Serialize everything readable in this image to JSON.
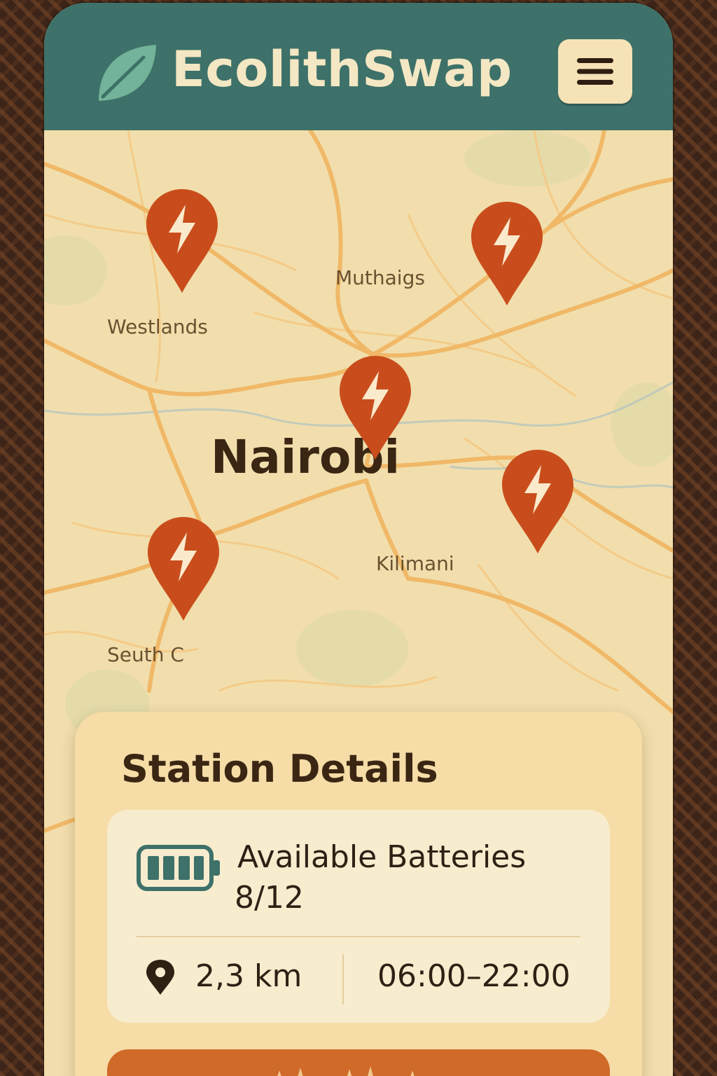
{
  "header": {
    "title": "EcolithSwap",
    "logo_icon": "leaf-icon",
    "menu_icon": "hamburger-menu-icon"
  },
  "map": {
    "city": "Nairobi",
    "places": [
      "Westlands",
      "Muthaigs",
      "Kilimani",
      "Seuth C"
    ],
    "station_pin_icon": "lightning-bolt-pin-icon",
    "station_count": 5
  },
  "station_details": {
    "title": "Station Details",
    "batteries_label": "Available Batteries",
    "batteries_count": "8/12",
    "distance": "2,3 km",
    "hours": "06:00–22:00"
  },
  "colors": {
    "header": "#3d7169",
    "accent": "#c94d1c",
    "card": "#f6dca6",
    "map": "#f1deac"
  }
}
